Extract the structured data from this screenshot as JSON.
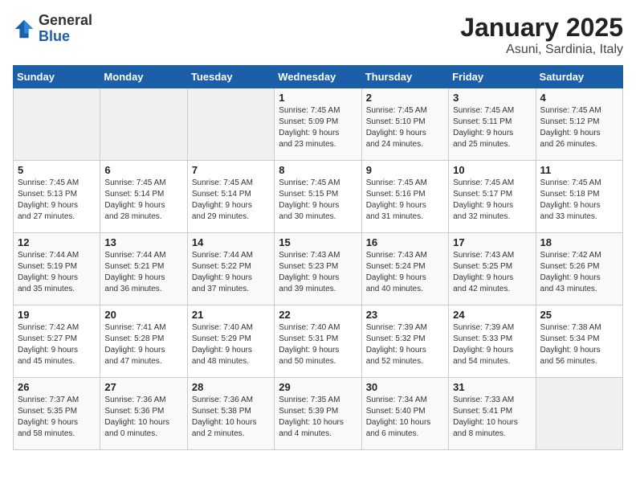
{
  "logo": {
    "general": "General",
    "blue": "Blue"
  },
  "title": "January 2025",
  "subtitle": "Asuni, Sardinia, Italy",
  "days_header": [
    "Sunday",
    "Monday",
    "Tuesday",
    "Wednesday",
    "Thursday",
    "Friday",
    "Saturday"
  ],
  "weeks": [
    [
      {
        "day": "",
        "info": ""
      },
      {
        "day": "",
        "info": ""
      },
      {
        "day": "",
        "info": ""
      },
      {
        "day": "1",
        "info": "Sunrise: 7:45 AM\nSunset: 5:09 PM\nDaylight: 9 hours\nand 23 minutes."
      },
      {
        "day": "2",
        "info": "Sunrise: 7:45 AM\nSunset: 5:10 PM\nDaylight: 9 hours\nand 24 minutes."
      },
      {
        "day": "3",
        "info": "Sunrise: 7:45 AM\nSunset: 5:11 PM\nDaylight: 9 hours\nand 25 minutes."
      },
      {
        "day": "4",
        "info": "Sunrise: 7:45 AM\nSunset: 5:12 PM\nDaylight: 9 hours\nand 26 minutes."
      }
    ],
    [
      {
        "day": "5",
        "info": "Sunrise: 7:45 AM\nSunset: 5:13 PM\nDaylight: 9 hours\nand 27 minutes."
      },
      {
        "day": "6",
        "info": "Sunrise: 7:45 AM\nSunset: 5:14 PM\nDaylight: 9 hours\nand 28 minutes."
      },
      {
        "day": "7",
        "info": "Sunrise: 7:45 AM\nSunset: 5:14 PM\nDaylight: 9 hours\nand 29 minutes."
      },
      {
        "day": "8",
        "info": "Sunrise: 7:45 AM\nSunset: 5:15 PM\nDaylight: 9 hours\nand 30 minutes."
      },
      {
        "day": "9",
        "info": "Sunrise: 7:45 AM\nSunset: 5:16 PM\nDaylight: 9 hours\nand 31 minutes."
      },
      {
        "day": "10",
        "info": "Sunrise: 7:45 AM\nSunset: 5:17 PM\nDaylight: 9 hours\nand 32 minutes."
      },
      {
        "day": "11",
        "info": "Sunrise: 7:45 AM\nSunset: 5:18 PM\nDaylight: 9 hours\nand 33 minutes."
      }
    ],
    [
      {
        "day": "12",
        "info": "Sunrise: 7:44 AM\nSunset: 5:19 PM\nDaylight: 9 hours\nand 35 minutes."
      },
      {
        "day": "13",
        "info": "Sunrise: 7:44 AM\nSunset: 5:21 PM\nDaylight: 9 hours\nand 36 minutes."
      },
      {
        "day": "14",
        "info": "Sunrise: 7:44 AM\nSunset: 5:22 PM\nDaylight: 9 hours\nand 37 minutes."
      },
      {
        "day": "15",
        "info": "Sunrise: 7:43 AM\nSunset: 5:23 PM\nDaylight: 9 hours\nand 39 minutes."
      },
      {
        "day": "16",
        "info": "Sunrise: 7:43 AM\nSunset: 5:24 PM\nDaylight: 9 hours\nand 40 minutes."
      },
      {
        "day": "17",
        "info": "Sunrise: 7:43 AM\nSunset: 5:25 PM\nDaylight: 9 hours\nand 42 minutes."
      },
      {
        "day": "18",
        "info": "Sunrise: 7:42 AM\nSunset: 5:26 PM\nDaylight: 9 hours\nand 43 minutes."
      }
    ],
    [
      {
        "day": "19",
        "info": "Sunrise: 7:42 AM\nSunset: 5:27 PM\nDaylight: 9 hours\nand 45 minutes."
      },
      {
        "day": "20",
        "info": "Sunrise: 7:41 AM\nSunset: 5:28 PM\nDaylight: 9 hours\nand 47 minutes."
      },
      {
        "day": "21",
        "info": "Sunrise: 7:40 AM\nSunset: 5:29 PM\nDaylight: 9 hours\nand 48 minutes."
      },
      {
        "day": "22",
        "info": "Sunrise: 7:40 AM\nSunset: 5:31 PM\nDaylight: 9 hours\nand 50 minutes."
      },
      {
        "day": "23",
        "info": "Sunrise: 7:39 AM\nSunset: 5:32 PM\nDaylight: 9 hours\nand 52 minutes."
      },
      {
        "day": "24",
        "info": "Sunrise: 7:39 AM\nSunset: 5:33 PM\nDaylight: 9 hours\nand 54 minutes."
      },
      {
        "day": "25",
        "info": "Sunrise: 7:38 AM\nSunset: 5:34 PM\nDaylight: 9 hours\nand 56 minutes."
      }
    ],
    [
      {
        "day": "26",
        "info": "Sunrise: 7:37 AM\nSunset: 5:35 PM\nDaylight: 9 hours\nand 58 minutes."
      },
      {
        "day": "27",
        "info": "Sunrise: 7:36 AM\nSunset: 5:36 PM\nDaylight: 10 hours\nand 0 minutes."
      },
      {
        "day": "28",
        "info": "Sunrise: 7:36 AM\nSunset: 5:38 PM\nDaylight: 10 hours\nand 2 minutes."
      },
      {
        "day": "29",
        "info": "Sunrise: 7:35 AM\nSunset: 5:39 PM\nDaylight: 10 hours\nand 4 minutes."
      },
      {
        "day": "30",
        "info": "Sunrise: 7:34 AM\nSunset: 5:40 PM\nDaylight: 10 hours\nand 6 minutes."
      },
      {
        "day": "31",
        "info": "Sunrise: 7:33 AM\nSunset: 5:41 PM\nDaylight: 10 hours\nand 8 minutes."
      },
      {
        "day": "",
        "info": ""
      }
    ]
  ]
}
